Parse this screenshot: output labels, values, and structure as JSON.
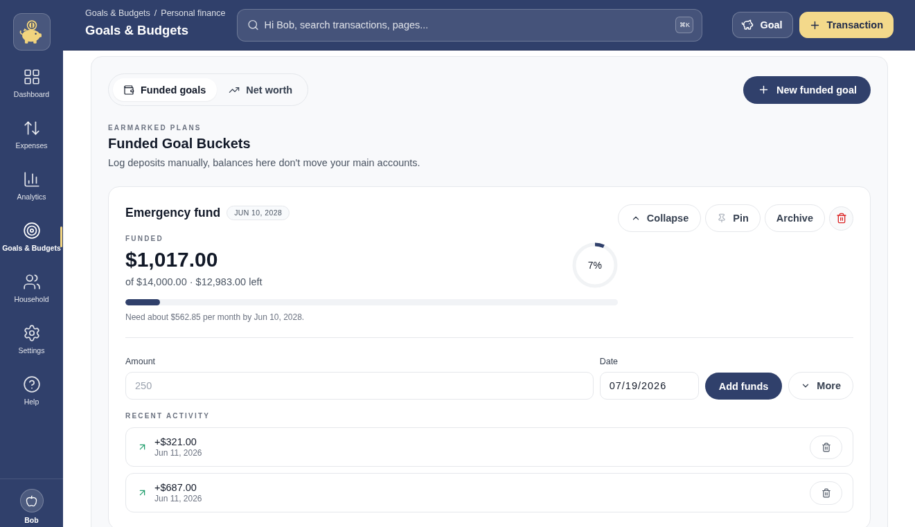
{
  "sidebar": {
    "items": [
      {
        "label": "Dashboard",
        "selected": false
      },
      {
        "label": "Expenses",
        "selected": false
      },
      {
        "label": "Analytics",
        "selected": false
      },
      {
        "label": "Goals & Budgets",
        "selected": true
      },
      {
        "label": "Household",
        "selected": false
      },
      {
        "label": "Settings",
        "selected": false
      },
      {
        "label": "Help",
        "selected": false
      }
    ],
    "user": {
      "name": "Bob"
    }
  },
  "header": {
    "breadcrumb": [
      "Goals & Budgets",
      "Personal finance"
    ],
    "breadcrumb_separator": "/",
    "title": "Goals & Budgets",
    "search": {
      "placeholder": "Hi Bob, search transactions, pages...",
      "shortcut": "⌘K"
    },
    "actions": [
      {
        "kind": "secondary",
        "label": "Goal"
      },
      {
        "kind": "primary",
        "label": "Transaction"
      }
    ]
  },
  "tabs": [
    {
      "label": "Funded goals",
      "selected": true
    },
    {
      "label": "Net worth",
      "selected": false
    }
  ],
  "new_goal_button": {
    "label": "New funded goal"
  },
  "section": {
    "eyebrow": "EARMARKED PLANS",
    "title": "Funded Goal Buckets",
    "description": "Log deposits manually, balances here don't move your main accounts."
  },
  "goal": {
    "name": "Emergency fund",
    "badge": "JUN 10, 2028",
    "actions": [
      {
        "kind": "collapse",
        "label": "Collapse"
      },
      {
        "kind": "pin",
        "label": "Pin"
      },
      {
        "kind": "archive",
        "label": "Archive"
      },
      {
        "kind": "delete"
      }
    ],
    "funded_label": "FUNDED",
    "amount": "$1,017.00",
    "summary": "of $14,000.00 · $12,983.00 left",
    "level": 0.07,
    "percent": "7%",
    "hint": "Need about $562.85 per month by Jun 10, 2028.",
    "form": {
      "amount": {
        "label": "Amount",
        "placeholder": "250"
      },
      "date": {
        "label": "Date",
        "value": "07/19/2026"
      },
      "submit": "Add funds",
      "more": "More"
    },
    "activity": {
      "title": "RECENT ACTIVITY",
      "items": [
        {
          "amount": "+$321.00",
          "date": "Jun 11, 2026"
        },
        {
          "amount": "+$687.00",
          "date": "Jun 11, 2026"
        }
      ]
    }
  }
}
